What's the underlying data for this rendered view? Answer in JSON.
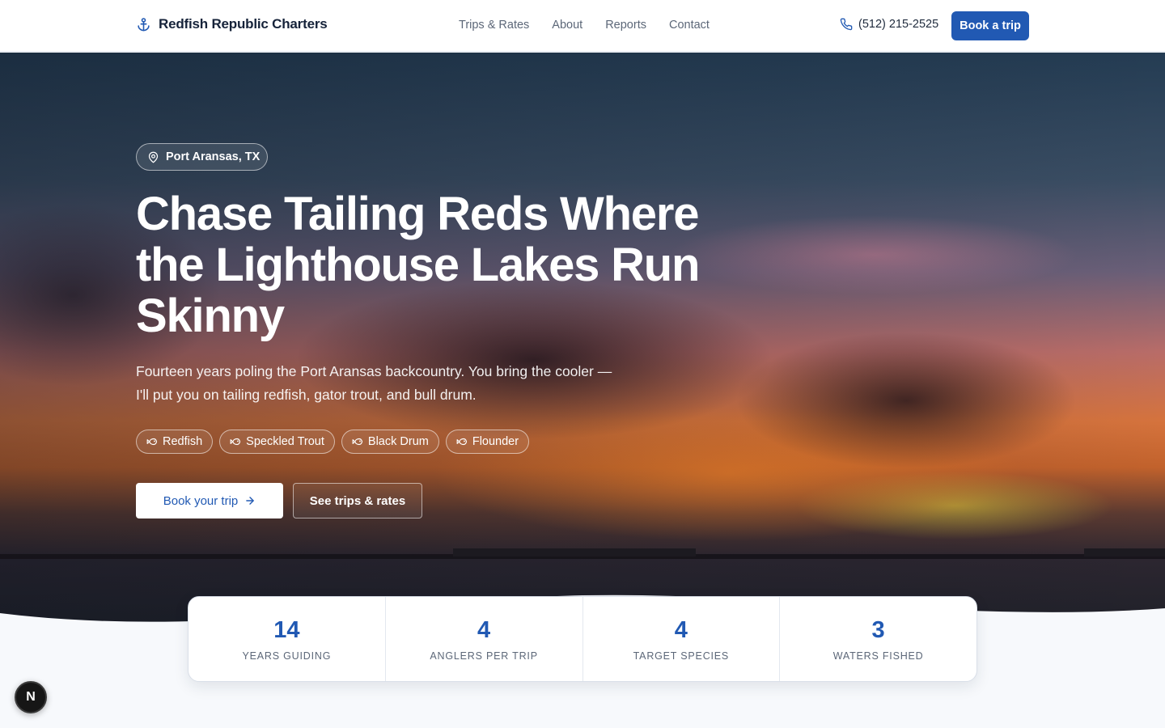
{
  "nav": {
    "brand": "Redfish Republic Charters",
    "brand_icon": "anchor-icon",
    "links": [
      "Trips & Rates",
      "About",
      "Reports",
      "Contact"
    ],
    "phone": "(512) 215-2525",
    "phone_icon": "phone-icon",
    "book_label": "Book a trip"
  },
  "hero": {
    "location": "Port Aransas, TX",
    "location_icon": "map-pin-icon",
    "headline": "Chase Tailing Reds Where the Lighthouse Lakes Run Skinny",
    "subtext": "Fourteen years poling the Port Aransas backcountry. You bring the cooler — I'll put you on tailing redfish, gator trout, and bull drum.",
    "species": [
      "Redfish",
      "Speckled Trout",
      "Black Drum",
      "Flounder"
    ],
    "species_icon": "fish-icon",
    "cta_primary": "Book your trip",
    "cta_primary_icon": "arrow-right-icon",
    "cta_secondary": "See trips & rates"
  },
  "stats": [
    {
      "value": "14",
      "label": "YEARS GUIDING"
    },
    {
      "value": "4",
      "label": "ANGLERS PER TRIP"
    },
    {
      "value": "4",
      "label": "TARGET SPECIES"
    },
    {
      "value": "3",
      "label": "WATERS FISHED"
    }
  ],
  "badge": "N",
  "colors": {
    "accent": "#2159b3",
    "brand_text": "#16233a",
    "muted_text": "#5c6778"
  }
}
